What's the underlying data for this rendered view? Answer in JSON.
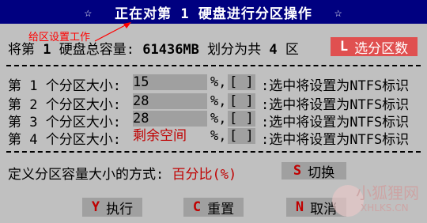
{
  "title": {
    "star_left": "☆",
    "text": "正在对第 1 硬盘进行分区操作",
    "star_right": "☆"
  },
  "annotation": {
    "text": "给区设置工作",
    "color": "#ff0000"
  },
  "capacity": {
    "prefix": "将第",
    "disk_num": "1",
    "label": "硬盘总容量:",
    "size": "61436MB",
    "divide_text": "划分为共",
    "count": "4",
    "unit": "区"
  },
  "select_button": {
    "key": "L",
    "label": "选分区数"
  },
  "partitions": [
    {
      "label": "第 1 个分区大小:",
      "value": "15",
      "pct": "%,",
      "check": "[ ]",
      "ntfs": ":选中将设置为NTFS标识"
    },
    {
      "label": "第 2 个分区大小:",
      "value": "28",
      "pct": "%,",
      "check": "[ ]",
      "ntfs": ":选中将设置为NTFS标识"
    },
    {
      "label": "第 3 个分区大小:",
      "value": "28",
      "pct": "%,",
      "check": "[ ]",
      "ntfs": ":选中将设置为NTFS标识"
    },
    {
      "label": "第 4 个分区大小:",
      "value": "剩余空间",
      "pct": "%,",
      "check": "[ ]",
      "ntfs": ":选中将设置为NTFS标识"
    }
  ],
  "method": {
    "label": "定义分区容量大小的方式:",
    "value": "百分比(%)"
  },
  "switch_button": {
    "key": "S",
    "label": "切换"
  },
  "buttons": {
    "execute": {
      "key": "Y",
      "label": "执行"
    },
    "reset": {
      "key": "C",
      "label": "重置"
    },
    "cancel": {
      "key": "N",
      "label": "取消"
    }
  },
  "watermark": {
    "cn": "小狐狸网",
    "en": "XHLKS.CN"
  },
  "colors": {
    "title_bg": "#000080",
    "panel_bg": "#c0c0c0",
    "accent_red": "#e05050",
    "value_red": "#c00000"
  }
}
